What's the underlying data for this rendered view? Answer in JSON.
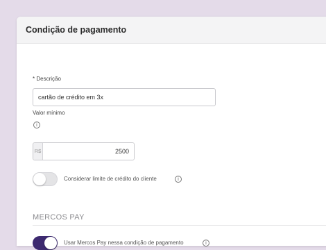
{
  "panel": {
    "title": "Condição de pagamento"
  },
  "form": {
    "description": {
      "required_mark": "*",
      "label": "Descrição",
      "value": "cartão de crédito em 3x"
    },
    "min_value": {
      "label": "Valor mínimo",
      "currency_prefix": "R$",
      "value": "2500"
    },
    "credit_limit_toggle": {
      "label": "Considerar limite de crédito do cliente",
      "checked": false
    }
  },
  "mercos_pay": {
    "section_title": "MERCOS PAY",
    "toggle": {
      "label": "Usar Mercos Pay nessa condição de pagamento",
      "checked": true
    }
  },
  "icons": {
    "info": "info-circle-icon"
  },
  "colors": {
    "background": "#e4dbe9",
    "toggle_on": "#3d2a70",
    "toggle_off": "#e4e4e6"
  }
}
